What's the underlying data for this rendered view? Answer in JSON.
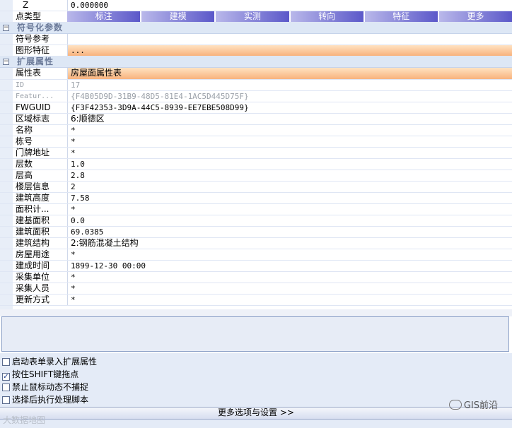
{
  "top": {
    "z_label": "Z",
    "z_value": "0.000000",
    "point_type_label": "点类型",
    "point_type_tabs": [
      "标注",
      "建模",
      "实测",
      "转向",
      "特征",
      "更多"
    ]
  },
  "symbol_section": {
    "title": "符号化参数",
    "rows": [
      {
        "label": "符号参考",
        "value": ""
      },
      {
        "label": "图形特征",
        "value": "..."
      }
    ]
  },
  "ext_section": {
    "title": "扩展属性",
    "table_label": "属性表",
    "table_value": "房屋面属性表",
    "rows": [
      {
        "label": "ID",
        "value": "17",
        "gray": true
      },
      {
        "label": "Featur...",
        "value": "{F4B05D9D-31B9-48D5-81E4-1AC5D445D75F}",
        "gray": true
      },
      {
        "label": "FWGUID",
        "value": "{F3F42353-3D9A-44C5-8939-EE7EBE508D99}"
      },
      {
        "label": "区域标志",
        "value": "6:顺德区"
      },
      {
        "label": "名称",
        "value": "*"
      },
      {
        "label": "栋号",
        "value": "*"
      },
      {
        "label": "门牌地址",
        "value": "*"
      },
      {
        "label": "层数",
        "value": "1.0"
      },
      {
        "label": "层高",
        "value": "2.8"
      },
      {
        "label": "楼层信息",
        "value": "2"
      },
      {
        "label": "建筑高度",
        "value": "7.58"
      },
      {
        "label": "面积计...",
        "value": "*"
      },
      {
        "label": "建基面积",
        "value": "0.0"
      },
      {
        "label": "建筑面积",
        "value": "69.0385"
      },
      {
        "label": "建筑结构",
        "value": "2:钢筋混凝土结构"
      },
      {
        "label": "房屋用途",
        "value": "*"
      },
      {
        "label": "建成时间",
        "value": "1899-12-30 00:00"
      },
      {
        "label": "采集单位",
        "value": "*"
      },
      {
        "label": "采集人员",
        "value": "*"
      },
      {
        "label": "更新方式",
        "value": "*"
      }
    ]
  },
  "options": [
    {
      "label": "启动表单录入扩展属性",
      "checked": false
    },
    {
      "label": "按住SHIFT键拖点",
      "checked": true
    },
    {
      "label": "禁止鼠标动态不捕捉",
      "checked": false
    },
    {
      "label": "选择后执行处理脚本",
      "checked": false
    }
  ],
  "more_button": "更多选项与设置 >>",
  "watermark_left": "大数据地图",
  "watermark_right": "GIS前沿",
  "colors": {
    "orange_cell": "#f8b27d",
    "tab_purple": "#5b58c9",
    "section_bg": "#dde7f5"
  }
}
